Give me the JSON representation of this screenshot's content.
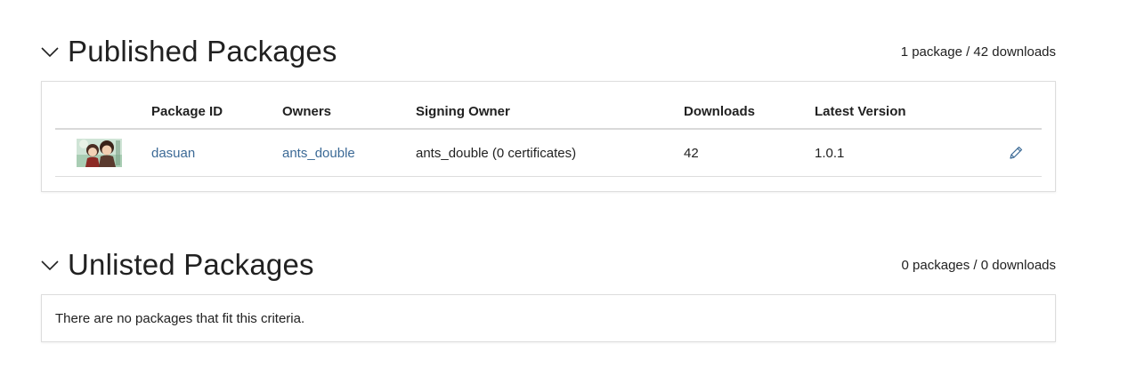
{
  "published": {
    "title": "Published Packages",
    "stats": "1 package / 42 downloads",
    "collapse_icon": "chevron-down-icon",
    "columns": [
      "Package ID",
      "Owners",
      "Signing Owner",
      "Downloads",
      "Latest Version"
    ],
    "rows": [
      {
        "icon": "package-icon",
        "package_id": "dasuan",
        "owners": "ants_double",
        "signing_owner": "ants_double (0 certificates)",
        "downloads": "42",
        "latest_version": "1.0.1",
        "edit_icon": "pencil-icon"
      }
    ]
  },
  "unlisted": {
    "title": "Unlisted Packages",
    "stats": "0 packages / 0 downloads",
    "collapse_icon": "chevron-down-icon",
    "empty_message": "There are no packages that fit this criteria."
  },
  "colors": {
    "link": "#3c6a96",
    "text": "#212121",
    "border": "#dddddd"
  }
}
